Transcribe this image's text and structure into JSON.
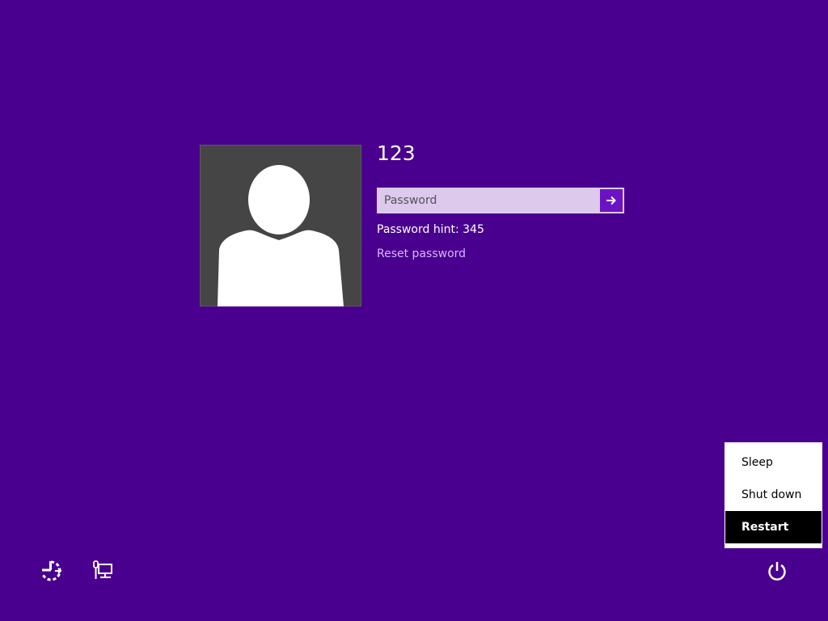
{
  "user": {
    "name": "123"
  },
  "password": {
    "placeholder": "Password",
    "value": ""
  },
  "hint_text": "Password hint: 345",
  "reset_link_label": "Reset password",
  "power_menu": {
    "items": [
      {
        "label": "Sleep",
        "selected": false
      },
      {
        "label": "Shut down",
        "selected": false
      },
      {
        "label": "Restart",
        "selected": true
      }
    ]
  },
  "icons": {
    "ease_of_access": "ease-of-access-icon",
    "network": "network-icon",
    "power": "power-icon",
    "submit_arrow": "arrow-right-icon"
  },
  "colors": {
    "background": "#4a008e",
    "input_fill": "#dcc9ec",
    "submit_fill": "#6b12c4",
    "link": "#d7b5ff",
    "avatar_tile": "#454545"
  }
}
